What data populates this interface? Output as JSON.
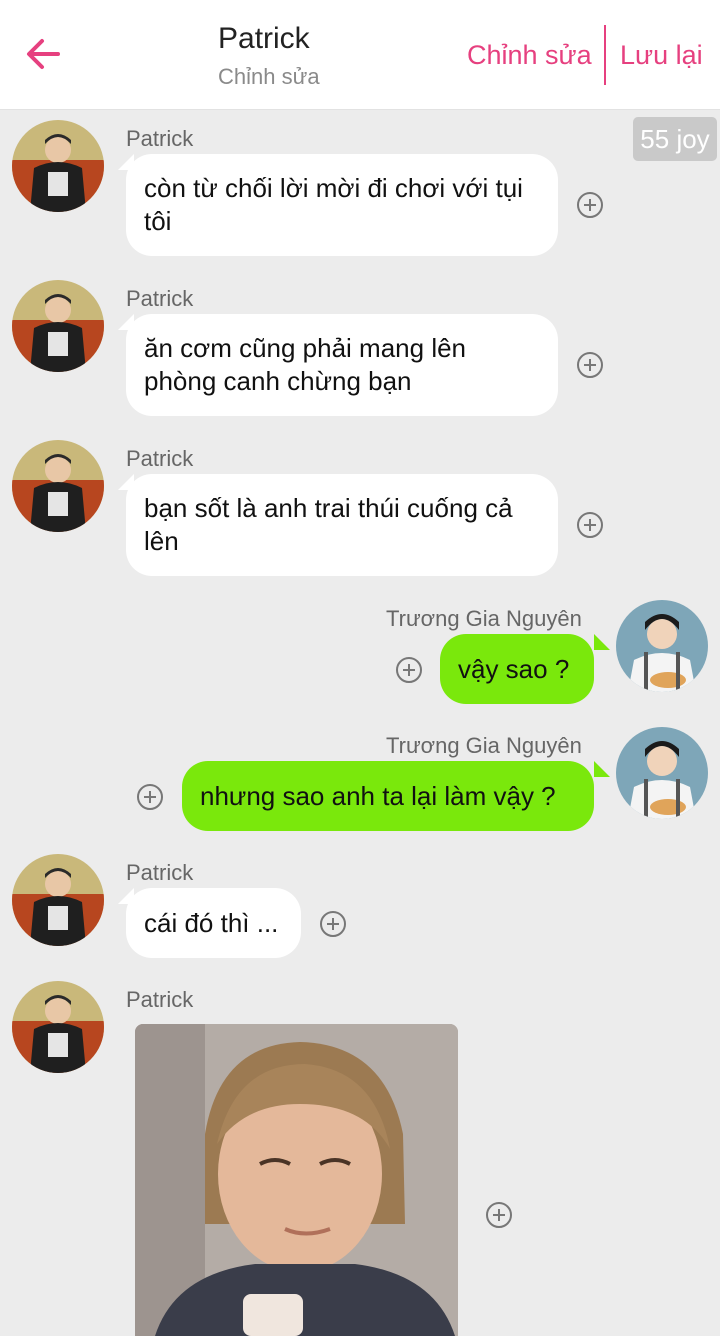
{
  "header": {
    "title": "Patrick",
    "subtitle": "Chỉnh sửa",
    "edit_label": "Chỉnh sửa",
    "save_label": "Lưu lại",
    "accent_color": "#e6407f"
  },
  "badge": {
    "text": "55 joy"
  },
  "messages": [
    {
      "sender": "Patrick",
      "text": "còn từ chối lời mời đi chơi với tụi tôi",
      "side": "left"
    },
    {
      "sender": "Patrick",
      "text": "ăn cơm cũng phải mang lên phòng canh chừng bạn",
      "side": "left"
    },
    {
      "sender": "Patrick",
      "text": "bạn sốt là anh trai thúi cuống cả lên",
      "side": "left"
    },
    {
      "sender": "Trương Gia Nguyên",
      "text": "vậy sao ?",
      "side": "right"
    },
    {
      "sender": "Trương Gia Nguyên",
      "text": "nhưng sao anh ta lại làm vậy ?",
      "side": "right"
    },
    {
      "sender": "Patrick",
      "text": "cái đó thì ...",
      "side": "left"
    },
    {
      "sender": "Patrick",
      "text": "",
      "side": "left",
      "type": "image"
    }
  ],
  "colors": {
    "right_bubble": "#7ae80c",
    "left_bubble": "#ffffff",
    "background": "#ececec"
  },
  "icons": {
    "back": "arrow-left-icon",
    "add": "plus-circle-icon"
  }
}
